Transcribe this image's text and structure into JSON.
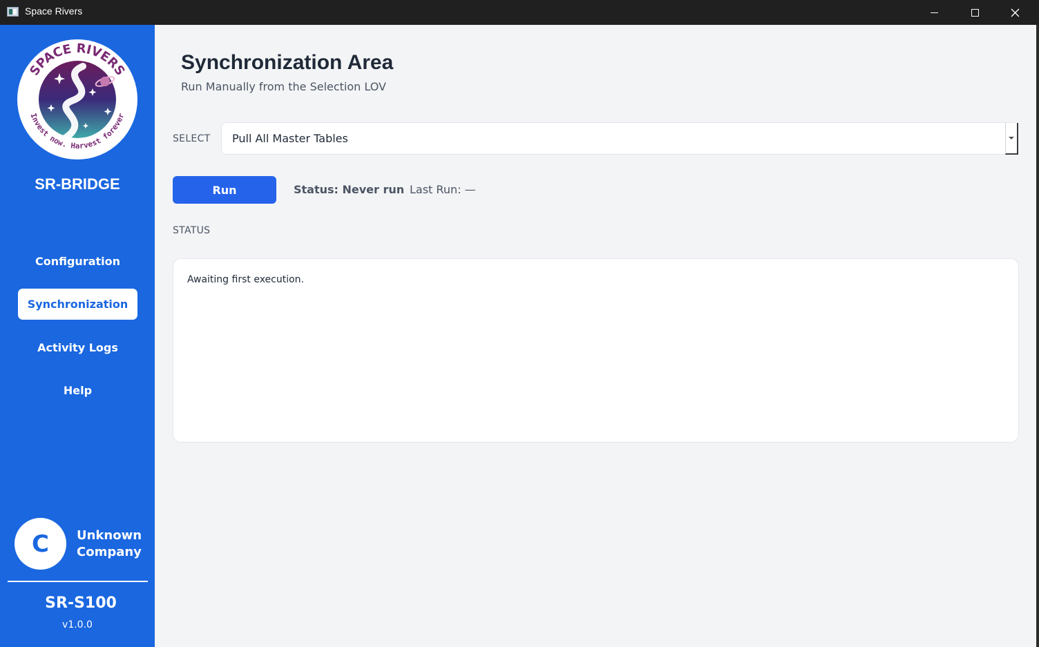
{
  "window": {
    "title": "Space Rivers",
    "minimize_icon": "minimize-icon",
    "maximize_icon": "maximize-icon",
    "close_icon": "close-icon"
  },
  "sidebar": {
    "logo": {
      "top_text": "SPACE RIVERS",
      "bottom_text": "Invest now. Harvest forever"
    },
    "brand": "SR-BRIDGE",
    "nav": {
      "configuration": "Configuration",
      "synchronization": "Synchronization",
      "activity_logs": "Activity Logs",
      "help": "Help"
    },
    "active_nav": "synchronization",
    "company": {
      "avatar_letter": "C",
      "line1": "Unknown",
      "line2": "Company"
    },
    "model": "SR-S100",
    "version": "v1.0.0"
  },
  "main": {
    "title": "Synchronization Area",
    "subtitle": "Run Manually from the Selection LOV",
    "select": {
      "label": "SELECT",
      "value": "Pull All Master Tables"
    },
    "run_label": "Run",
    "status_inline": "Status: Never run",
    "last_run": "Last Run: —",
    "status_section_label": "STATUS",
    "status_text": "Awaiting first execution."
  },
  "colors": {
    "sidebar_bg": "#1a67e0",
    "accent": "#2563eb",
    "content_bg": "#f3f4f6",
    "titlebar_bg": "#202020"
  }
}
